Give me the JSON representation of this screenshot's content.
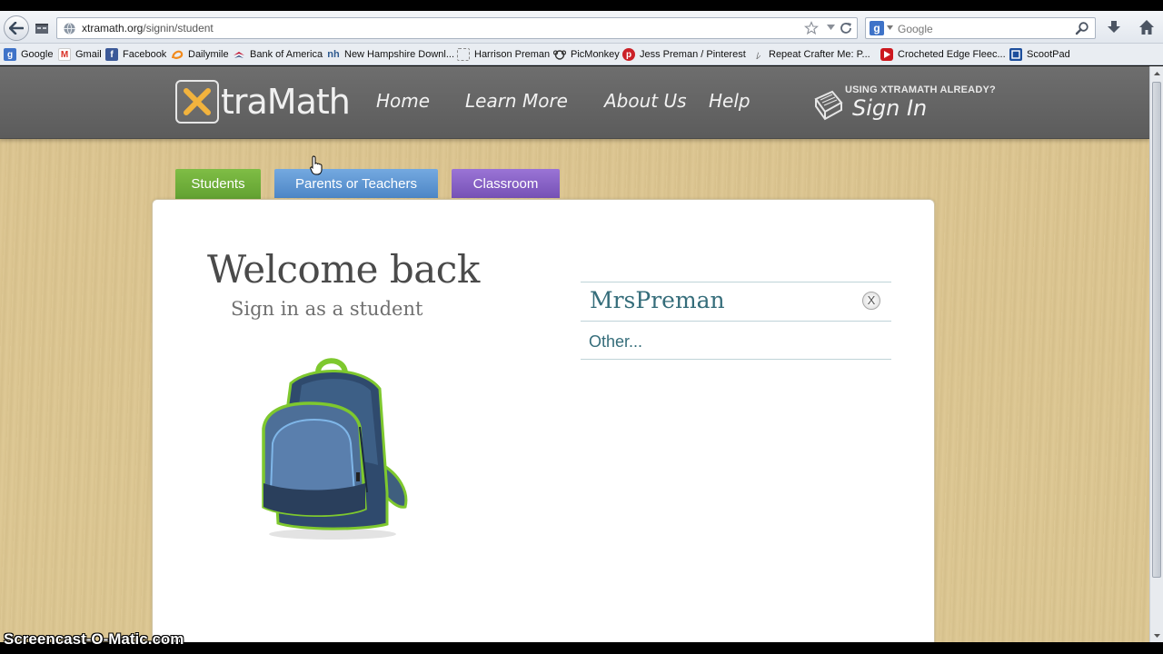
{
  "browser": {
    "url_domain": "xtramath.org",
    "url_path": "/signin/student",
    "search_placeholder": "Google",
    "bookmarks": [
      {
        "label": "Google",
        "icon": "google-icon",
        "color": "#3f73c8"
      },
      {
        "label": "Gmail",
        "icon": "gmail-icon",
        "color": "#d93025"
      },
      {
        "label": "Facebook",
        "icon": "facebook-icon",
        "color": "#3b5998"
      },
      {
        "label": "Dailymile",
        "icon": "dailymile-icon",
        "color": "#f28a1c"
      },
      {
        "label": "Bank of America",
        "icon": "bank-of-america-icon",
        "color": "#c41230"
      },
      {
        "label": "New Hampshire Downl...",
        "icon": "new-hampshire-icon",
        "color": "#2e5a8f"
      },
      {
        "label": "Harrison Preman",
        "icon": "page-icon",
        "color": "#888888"
      },
      {
        "label": "PicMonkey",
        "icon": "picmonkey-icon",
        "color": "#333333"
      },
      {
        "label": "Jess Preman / Pinterest",
        "icon": "pinterest-icon",
        "color": "#cb2027"
      },
      {
        "label": "Repeat Crafter Me: P...",
        "icon": "repeat-crafter-icon",
        "color": "#555555"
      },
      {
        "label": "Crocheted Edge Fleec...",
        "icon": "youtube-icon",
        "color": "#cc181e"
      },
      {
        "label": "ScootPad",
        "icon": "scootpad-icon",
        "color": "#1d4e9c"
      }
    ]
  },
  "site": {
    "logo_x": "X",
    "logo_rest": "traMath",
    "nav": {
      "home": "Home",
      "learn_more": "Learn More",
      "about_us": "About Us",
      "help": "Help"
    },
    "signin_small": "USING XTRAMATH ALREADY?",
    "signin_big": "Sign In",
    "colors": {
      "header": "#646464",
      "students_tab": "#6aaa37",
      "parents_tab": "#5b93d0",
      "classroom_tab": "#8461c4",
      "list_text": "#356d7a"
    }
  },
  "tabs": {
    "students": "Students",
    "parents": "Parents or Teachers",
    "classroom": "Classroom"
  },
  "main": {
    "title": "Welcome back",
    "subtitle": "Sign in as a student",
    "teacher_name": "MrsPreman",
    "remove_glyph": "X",
    "other": "Other..."
  },
  "overlay": {
    "watermark": "Screencast-O-Matic.com"
  }
}
